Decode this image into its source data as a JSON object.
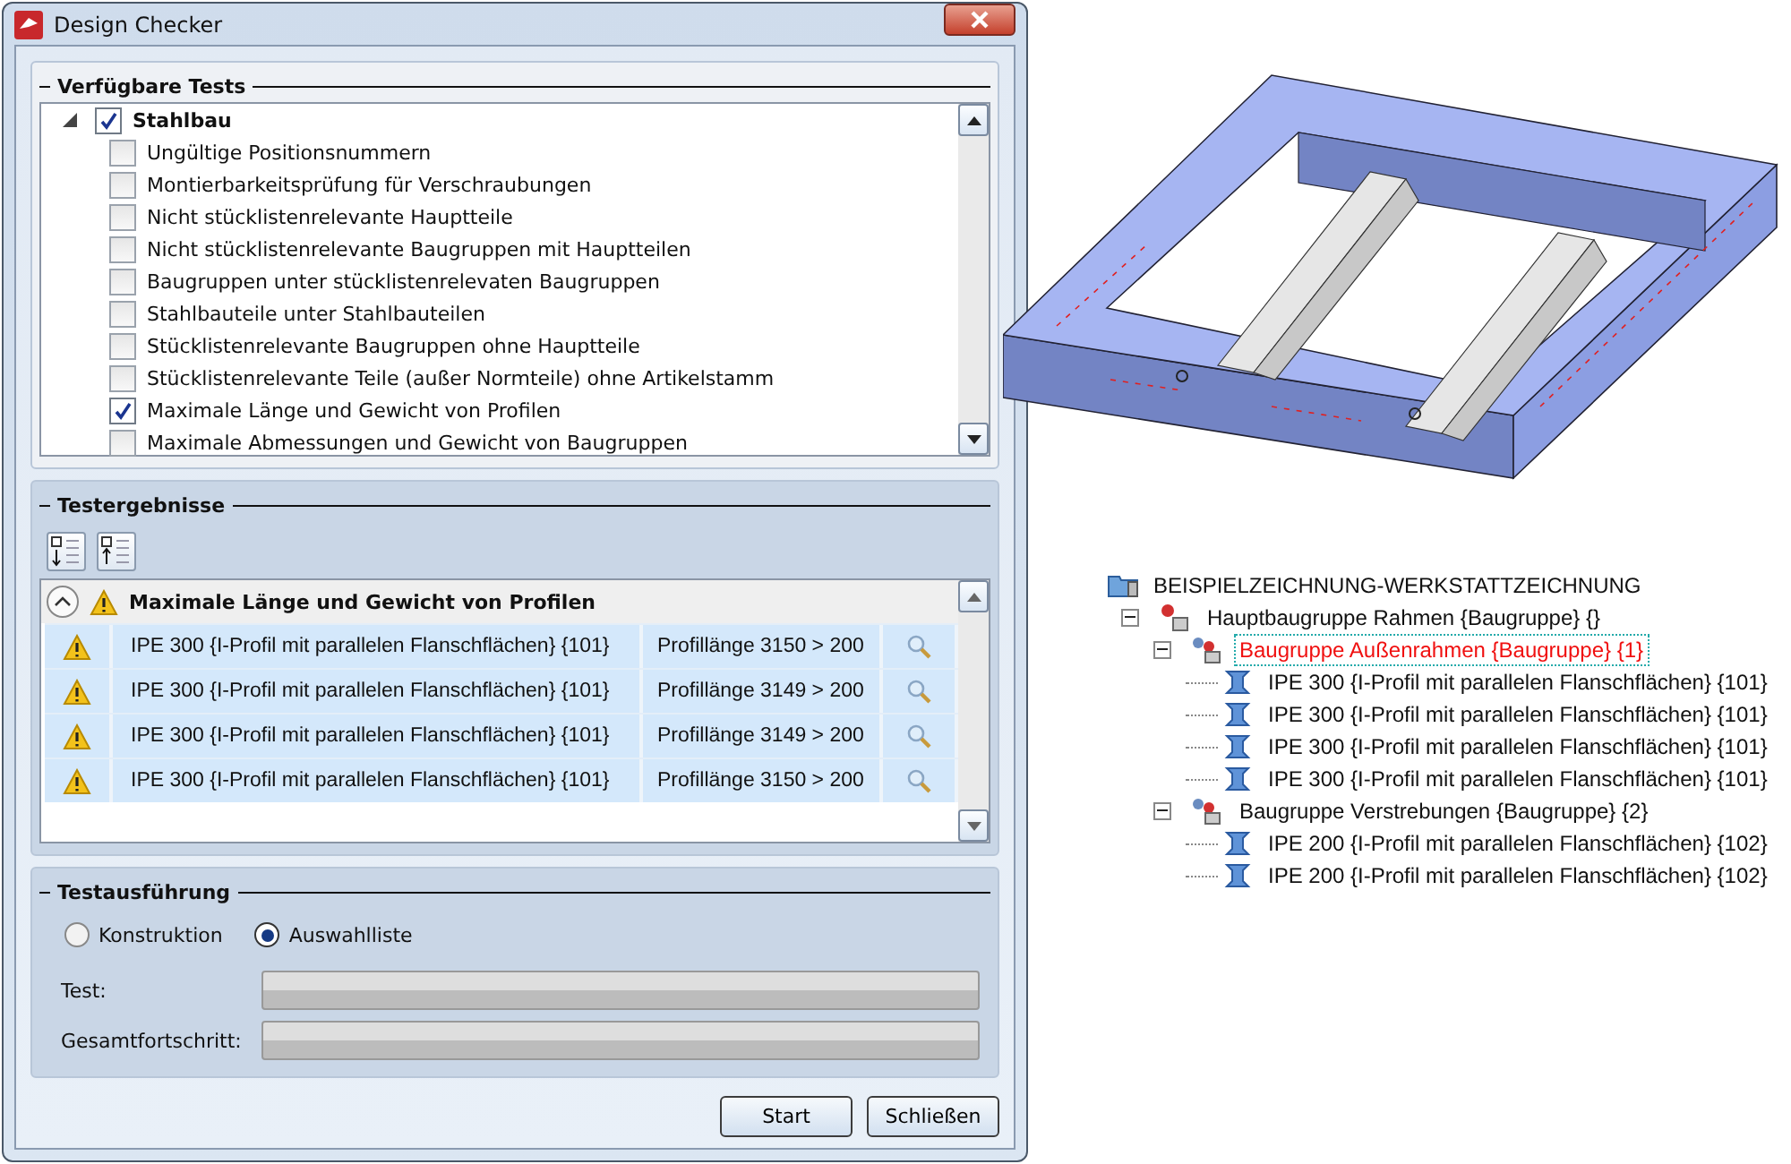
{
  "window": {
    "title": "Design Checker"
  },
  "available_tests": {
    "title": "Verfügbare Tests",
    "category": {
      "label": "Stahlbau",
      "expanded": true,
      "checked": true,
      "tests": [
        {
          "label": "Ungültige Positionsnummern",
          "checked": false
        },
        {
          "label": "Montierbarkeitsprüfung für Verschraubungen",
          "checked": false
        },
        {
          "label": "Nicht stücklistenrelevante Hauptteile",
          "checked": false
        },
        {
          "label": "Nicht stücklistenrelevante Baugruppen mit Hauptteilen",
          "checked": false
        },
        {
          "label": "Baugruppen unter stücklistenrelevaten Baugruppen",
          "checked": false
        },
        {
          "label": "Stahlbauteile unter Stahlbauteilen",
          "checked": false
        },
        {
          "label": "Stücklistenrelevante Baugruppen ohne Hauptteile",
          "checked": false
        },
        {
          "label": "Stücklistenrelevante Teile (außer Normteile) ohne Artikelstamm",
          "checked": false
        },
        {
          "label": "Maximale Länge und Gewicht von Profilen",
          "checked": true
        },
        {
          "label": "Maximale Abmessungen und Gewicht von Baugruppen",
          "checked": false
        }
      ]
    }
  },
  "results": {
    "title": "Testergebnisse",
    "group": {
      "title": "Maximale Länge und Gewicht von Profilen",
      "expanded": true
    },
    "rows": [
      {
        "name": "IPE 300 {I-Profil mit parallelen Flanschflächen} {101}",
        "message": "Profillänge 3150 > 200"
      },
      {
        "name": "IPE 300 {I-Profil mit parallelen Flanschflächen} {101}",
        "message": "Profillänge 3149 > 200"
      },
      {
        "name": "IPE 300 {I-Profil mit parallelen Flanschflächen} {101}",
        "message": "Profillänge 3149 > 200"
      },
      {
        "name": "IPE 300 {I-Profil mit parallelen Flanschflächen} {101}",
        "message": "Profillänge 3150 > 200"
      }
    ]
  },
  "execution": {
    "title": "Testausführung",
    "modes": [
      {
        "label": "Konstruktion",
        "selected": false
      },
      {
        "label": "Auswahlliste",
        "selected": true
      }
    ],
    "progress": [
      {
        "label": "Test:",
        "level": 0
      },
      {
        "label": "Gesamtfortschritt:",
        "level": 0
      }
    ]
  },
  "buttons": [
    "Start",
    "Schließen"
  ],
  "model_tree": {
    "label": "BEISPIELZEICHNUNG-WERKSTATTZEICHNUNG",
    "children": [
      {
        "label": "Hauptbaugruppe Rahmen {Baugruppe} {}",
        "kind": "main-assembly",
        "selected": false,
        "expanded": true,
        "children": [
          {
            "label": "Baugruppe Außenrahmen {Baugruppe} {1}",
            "kind": "assembly",
            "selected": true,
            "expanded": true,
            "children": [
              {
                "label": "IPE 300 {I-Profil mit parallelen Flanschflächen} {101}",
                "kind": "profile",
                "selected": false
              },
              {
                "label": "IPE 300 {I-Profil mit parallelen Flanschflächen} {101}",
                "kind": "profile",
                "selected": false
              },
              {
                "label": "IPE 300 {I-Profil mit parallelen Flanschflächen} {101}",
                "kind": "profile",
                "selected": false
              },
              {
                "label": "IPE 300 {I-Profil mit parallelen Flanschflächen} {101}",
                "kind": "profile",
                "selected": false
              }
            ]
          },
          {
            "label": "Baugruppe Verstrebungen {Baugruppe} {2}",
            "kind": "assembly",
            "selected": false,
            "expanded": true,
            "children": [
              {
                "label": "IPE 200 {I-Profil mit parallelen Flanschflächen} {102}",
                "kind": "profile",
                "selected": false
              },
              {
                "label": "IPE 200 {I-Profil mit parallelen Flanschflächen} {102}",
                "kind": "profile",
                "selected": false
              }
            ]
          }
        ]
      }
    ]
  }
}
